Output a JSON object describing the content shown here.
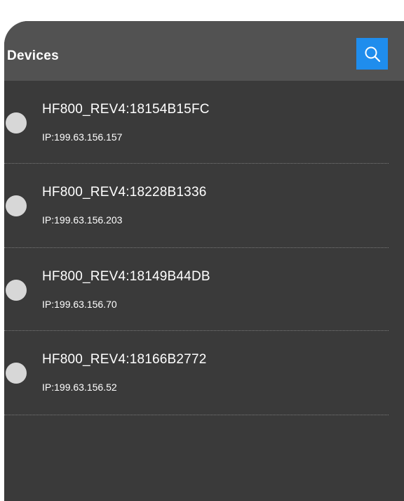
{
  "header": {
    "title": "Devices",
    "search_icon": "search-icon"
  },
  "colors": {
    "panel_bg": "#3a3a3a",
    "header_bg": "#525252",
    "accent": "#1f8ded",
    "status_dot": "#d7d7d7"
  },
  "devices": [
    {
      "name": "HF800_REV4:18154B15FC",
      "ip": "IP:199.63.156.157"
    },
    {
      "name": "HF800_REV4:18228B1336",
      "ip": "IP:199.63.156.203"
    },
    {
      "name": "HF800_REV4:18149B44DB",
      "ip": "IP:199.63.156.70"
    },
    {
      "name": "HF800_REV4:18166B2772",
      "ip": "IP:199.63.156.52"
    }
  ]
}
